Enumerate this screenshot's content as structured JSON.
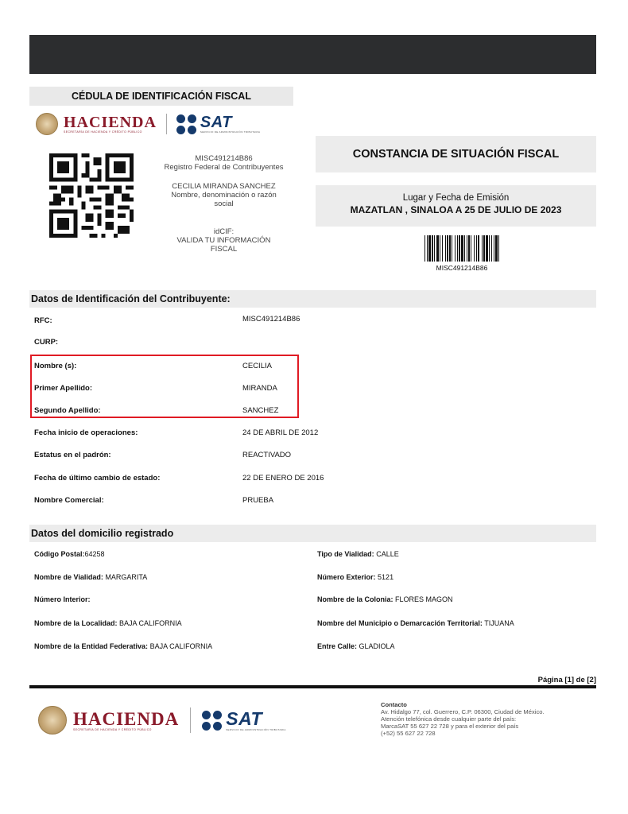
{
  "cedula_title": "CÉDULA DE IDENTIFICACIÓN FISCAL",
  "logos": {
    "hacienda": "HACIENDA",
    "hacienda_sub": "SECRETARÍA DE HACIENDA Y CRÉDITO PÚBLICO",
    "sat": "SAT",
    "sat_sub": "SERVICIO DE ADMINISTRACIÓN TRIBUTARIA"
  },
  "id_block": {
    "rfc": "MISC491214B86",
    "rfc_caption": "Registro Federal de Contribuyentes",
    "name": "CECILIA MIRANDA SANCHEZ",
    "name_caption_1": "Nombre, denominación o razón",
    "name_caption_2": "social",
    "idcif": "idCIF:",
    "valida_1": "VALIDA TU INFORMACIÓN",
    "valida_2": "FISCAL"
  },
  "constancia_title": "CONSTANCIA DE SITUACIÓN FISCAL",
  "lugar": {
    "caption": "Lugar y Fecha de Emisión",
    "value": "MAZATLAN , SINALOA A 25 DE JULIO DE 2023"
  },
  "barcode_label": "MISC491214B86",
  "section_contribuyente": "Datos de Identificación del Contribuyente:",
  "contribuyente": [
    {
      "label": "RFC:",
      "value": "MISC491214B86"
    },
    {
      "label": "CURP:",
      "value": ""
    },
    {
      "label": "Nombre (s):",
      "value": "CECILIA"
    },
    {
      "label": "Primer Apellido:",
      "value": "MIRANDA"
    },
    {
      "label": "Segundo Apellido:",
      "value": "SANCHEZ"
    },
    {
      "label": "Fecha inicio de operaciones:",
      "value": "24 DE ABRIL DE 2012"
    },
    {
      "label": "Estatus en el padrón:",
      "value": "REACTIVADO"
    },
    {
      "label": "Fecha de último cambio de estado:",
      "value": "22 DE ENERO DE 2016"
    },
    {
      "label": "Nombre Comercial:",
      "value": "PRUEBA"
    }
  ],
  "section_domicilio": "Datos del domicilio registrado",
  "domicilio": [
    {
      "label": "Código Postal:",
      "value": "64258"
    },
    {
      "label": "Tipo de Vialidad:",
      "value": "CALLE"
    },
    {
      "label": "Nombre de Vialidad:",
      "value": "MARGARITA"
    },
    {
      "label": "Número Exterior:",
      "value": "5121"
    },
    {
      "label": "Número Interior:",
      "value": ""
    },
    {
      "label": "Nombre de la Colonia:",
      "value": "FLORES MAGON"
    },
    {
      "label": "Nombre de la Localidad:",
      "value": "BAJA CALIFORNIA"
    },
    {
      "label": "Nombre del Municipio o Demarcación Territorial:",
      "value": "TIJUANA"
    },
    {
      "label": "Nombre de la Entidad Federativa:",
      "value": "BAJA CALIFORNIA"
    },
    {
      "label": "Entre Calle:",
      "value": "GLADIOLA"
    }
  ],
  "pagina": "Página  [1] de [2]",
  "contacto": {
    "title": "Contacto",
    "line1": "Av. Hidalgo 77, col. Guerrero, C.P. 06300, Ciudad de México.",
    "line2": "Atención telefónica desde cualquier parte del país:",
    "line3": "MarcaSAT 55 627 22 728 y para el exterior del país",
    "line4": "(+52) 55 627 22 728"
  },
  "colors": {
    "topbar": "#2c2d2f",
    "band": "#ececec",
    "highlight": "#e01b24",
    "hacienda": "#8a1a2a",
    "sat": "#153a6c"
  }
}
